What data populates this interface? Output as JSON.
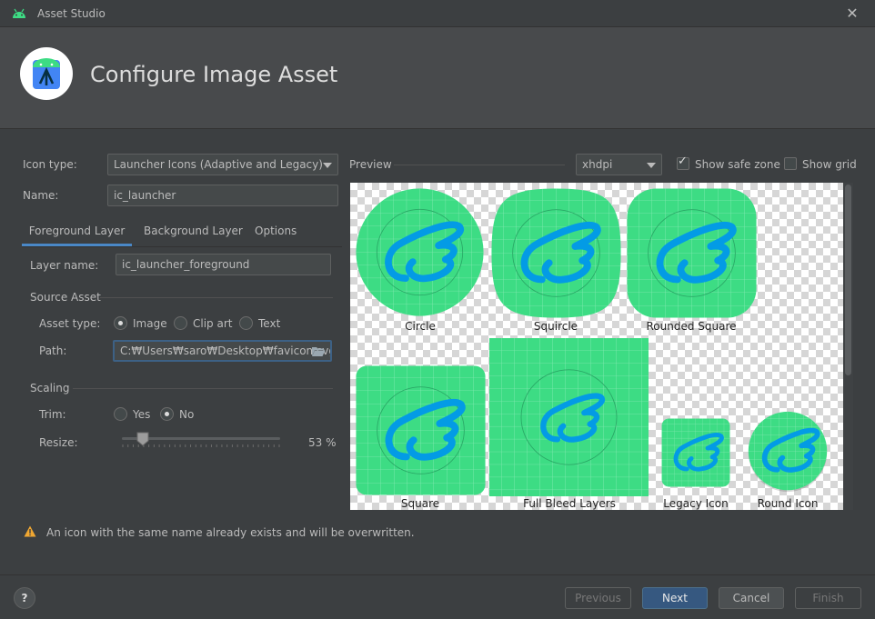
{
  "window": {
    "title": "Asset Studio",
    "close_glyph": "✕"
  },
  "header": {
    "title": "Configure Image Asset"
  },
  "form": {
    "icon_type_label": "Icon type:",
    "icon_type_value": "Launcher Icons (Adaptive and Legacy)",
    "name_label": "Name:",
    "name_value": "ic_launcher"
  },
  "tabs": [
    {
      "label": "Foreground Layer",
      "active": true
    },
    {
      "label": "Background Layer",
      "active": false
    },
    {
      "label": "Options",
      "active": false
    }
  ],
  "foreground": {
    "layer_name_label": "Layer name:",
    "layer_name_value": "ic_launcher_foreground",
    "source_asset_title": "Source Asset",
    "asset_type_label": "Asset type:",
    "asset_type_options": [
      {
        "label": "Image",
        "checked": true
      },
      {
        "label": "Clip art",
        "checked": false
      },
      {
        "label": "Text",
        "checked": false
      }
    ],
    "path_label": "Path:",
    "path_value": "C:₩Users₩saro₩Desktop₩favicon.svg",
    "scaling_title": "Scaling",
    "trim_label": "Trim:",
    "trim_options": [
      {
        "label": "Yes",
        "checked": false
      },
      {
        "label": "No",
        "checked": true
      }
    ],
    "resize_label": "Resize:",
    "resize_value": 53,
    "resize_text": "53 %"
  },
  "preview": {
    "label": "Preview",
    "density_value": "xhdpi",
    "show_safe_zone_label": "Show safe zone",
    "show_safe_zone_checked": true,
    "show_grid_label": "Show grid",
    "show_grid_checked": false,
    "captions": {
      "circle": "Circle",
      "squircle": "Squircle",
      "rounded_square": "Rounded Square",
      "square": "Square",
      "full_bleed": "Full Bleed Layers",
      "legacy": "Legacy Icon",
      "round": "Round Icon"
    }
  },
  "warning": {
    "text": "An icon with the same name already exists and will be overwritten."
  },
  "footer": {
    "help_label": "?",
    "previous_label": "Previous",
    "next_label": "Next",
    "cancel_label": "Cancel",
    "finish_label": "Finish"
  },
  "colors": {
    "icon_green": "#3ddc84",
    "icon_blue": "#039be5",
    "accent": "#365880",
    "warning": "#f0a732"
  }
}
